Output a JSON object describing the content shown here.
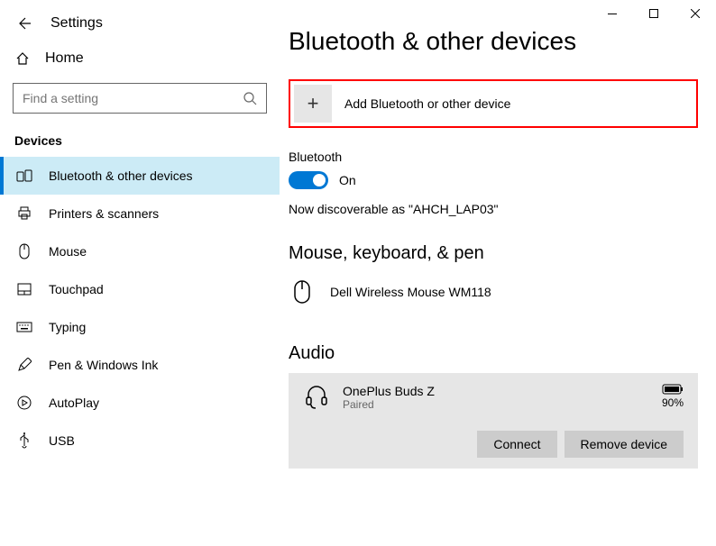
{
  "titlebar": {
    "app_title": "Settings"
  },
  "sidebar": {
    "home_label": "Home",
    "search_placeholder": "Find a setting",
    "section_label": "Devices",
    "items": [
      {
        "label": "Bluetooth & other devices",
        "selected": true
      },
      {
        "label": "Printers & scanners"
      },
      {
        "label": "Mouse"
      },
      {
        "label": "Touchpad"
      },
      {
        "label": "Typing"
      },
      {
        "label": "Pen & Windows Ink"
      },
      {
        "label": "AutoPlay"
      },
      {
        "label": "USB"
      }
    ]
  },
  "main": {
    "page_title": "Bluetooth & other devices",
    "add_device_label": "Add Bluetooth or other device",
    "bluetooth": {
      "label": "Bluetooth",
      "state": "On",
      "discoverable": "Now discoverable as \"AHCH_LAP03\""
    },
    "mouse_section": {
      "title": "Mouse, keyboard, & pen",
      "devices": [
        {
          "name": "Dell Wireless Mouse WM118"
        }
      ]
    },
    "audio_section": {
      "title": "Audio",
      "device": {
        "name": "OnePlus Buds Z",
        "status": "Paired",
        "battery": "90%"
      },
      "connect_label": "Connect",
      "remove_label": "Remove device"
    }
  }
}
